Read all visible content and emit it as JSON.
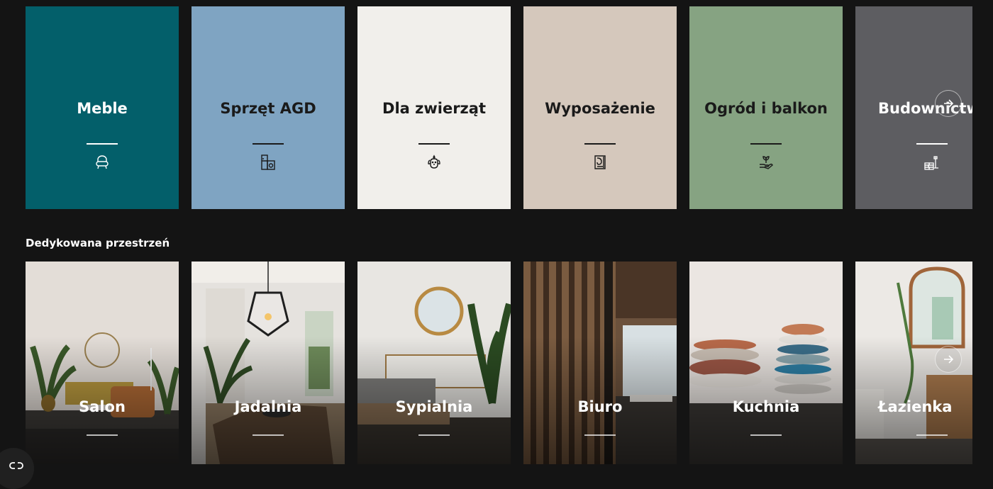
{
  "categories": [
    {
      "title": "Meble",
      "bg": "#035f6a",
      "icon": "armchair-icon"
    },
    {
      "title": "Sprzęt AGD",
      "bg": "#7fa4c2",
      "icon": "appliances-icon"
    },
    {
      "title": "Dla zwierząt",
      "bg": "#f1efeb",
      "icon": "dog-icon"
    },
    {
      "title": "Wyposażenie",
      "bg": "#d5c8bc",
      "icon": "wallpaper-roll-icon"
    },
    {
      "title": "Ogród i balkon",
      "bg": "#86a382",
      "icon": "plant-hand-icon"
    },
    {
      "title": "Budownictw",
      "bg": "#5d5d61",
      "icon": "tools-bricks-icon"
    }
  ],
  "section": {
    "title": "Dedykowana przestrzeń"
  },
  "rooms": [
    {
      "title": "Salon",
      "icon": "living-room-photo"
    },
    {
      "title": "Jadalnia",
      "icon": "dining-room-photo"
    },
    {
      "title": "Sypialnia",
      "icon": "bedroom-photo"
    },
    {
      "title": "Biuro",
      "icon": "office-photo"
    },
    {
      "title": "Kuchnia",
      "icon": "kitchen-photo"
    },
    {
      "title": "Łazienka",
      "icon": "bathroom-photo"
    }
  ],
  "controls": {
    "next_icon": "arrow-right-icon",
    "widget_icon": "accessibility-link-icon"
  }
}
